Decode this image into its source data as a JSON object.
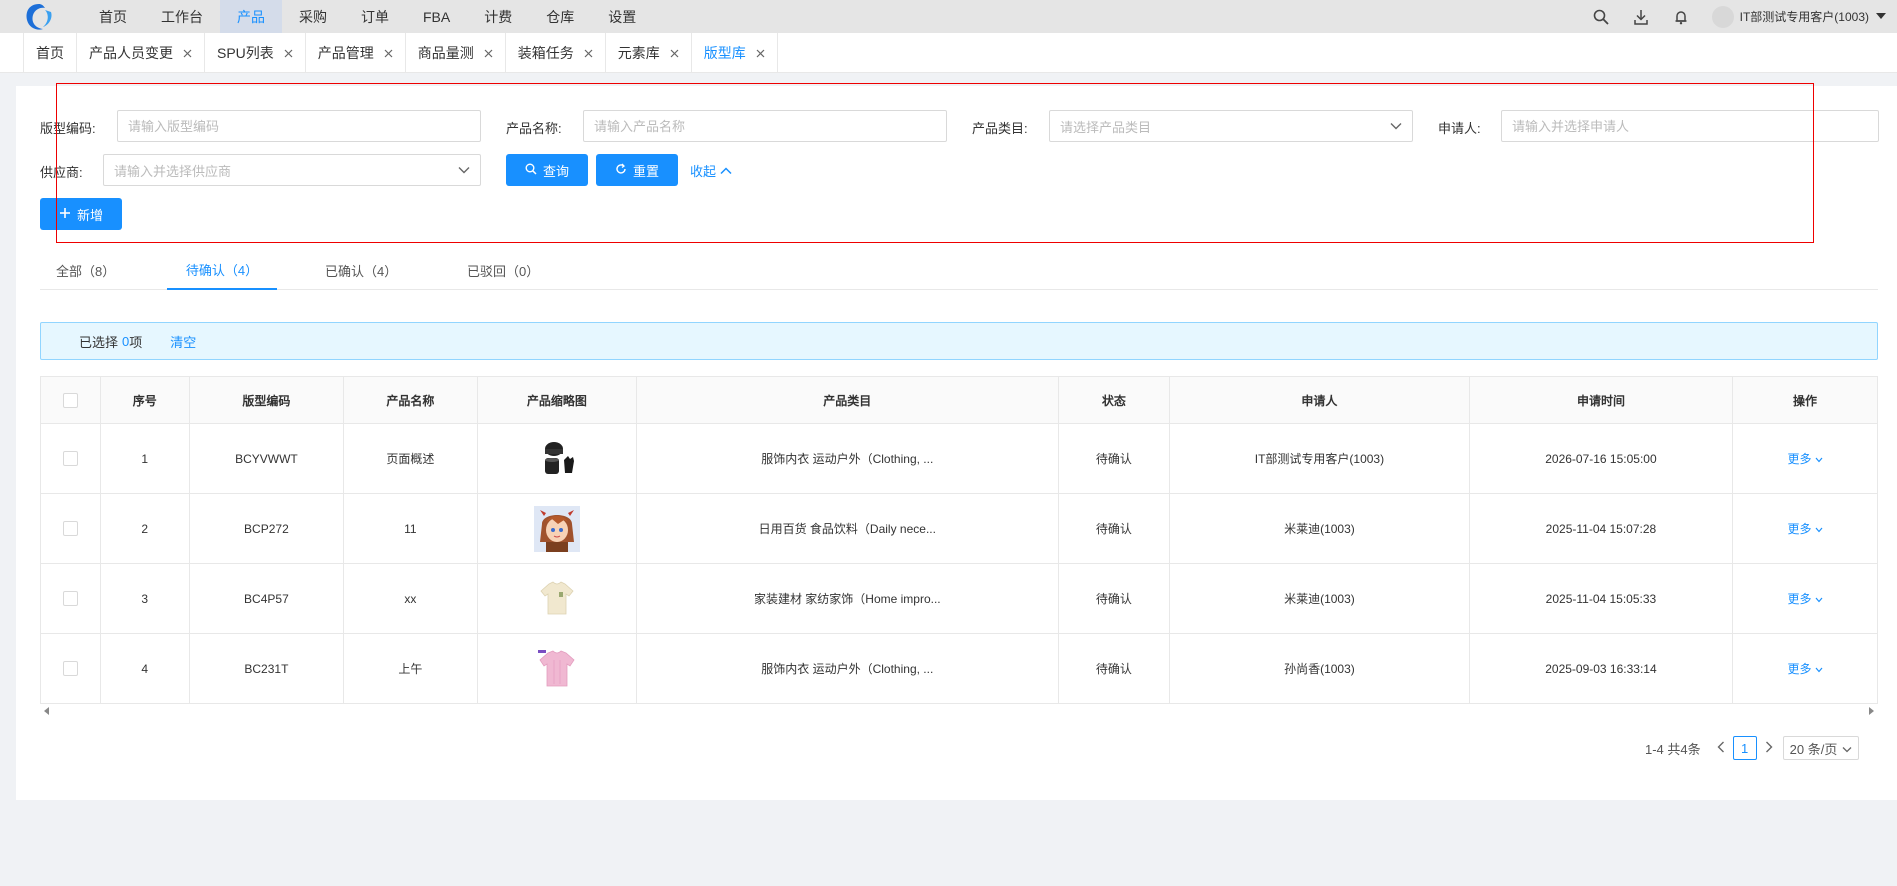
{
  "nav": {
    "items": [
      "首页",
      "工作台",
      "产品",
      "采购",
      "订单",
      "FBA",
      "计费",
      "仓库",
      "设置"
    ],
    "active_index": 2,
    "user_label": "IT部测试专用客户(1003)",
    "icons": [
      "search-icon",
      "download-icon",
      "bell-icon",
      "caret-down-icon"
    ]
  },
  "tabs": [
    {
      "label": "首页",
      "closable": false
    },
    {
      "label": "产品人员变更",
      "closable": true
    },
    {
      "label": "SPU列表",
      "closable": true
    },
    {
      "label": "产品管理",
      "closable": true
    },
    {
      "label": "商品量测",
      "closable": true
    },
    {
      "label": "装箱任务",
      "closable": true
    },
    {
      "label": "元素库",
      "closable": true
    },
    {
      "label": "版型库",
      "closable": true,
      "active": true
    }
  ],
  "filters": {
    "code_label": "版型编码:",
    "code_placeholder": "请输入版型编码",
    "name_label": "产品名称:",
    "name_placeholder": "请输入产品名称",
    "category_label": "产品类目:",
    "category_placeholder": "请选择产品类目",
    "applicant_label": "申请人:",
    "applicant_placeholder": "请输入并选择申请人",
    "supplier_label": "供应商:",
    "supplier_placeholder": "请输入并选择供应商",
    "search_label": "查询",
    "reset_label": "重置",
    "collapse_label": "收起",
    "add_label": "新增"
  },
  "status_tabs": [
    {
      "label": "全部（8）"
    },
    {
      "label": "待确认（4）",
      "active": true
    },
    {
      "label": "已确认（4）"
    },
    {
      "label": "已驳回（0）"
    }
  ],
  "selection": {
    "prefix": "已选择",
    "count": "0",
    "suffix": "项",
    "clear_label": "清空"
  },
  "table": {
    "columns": [
      "序号",
      "版型编码",
      "产品名称",
      "产品缩略图",
      "产品类目",
      "状态",
      "申请人",
      "申请时间",
      "操作"
    ],
    "rows": [
      {
        "index": "1",
        "code": "BCYVWWT",
        "name": "页面概述",
        "thumb": "hat-gloves",
        "category": "服饰内衣 运动户外（Clothing, ...",
        "status": "待确认",
        "applicant": "IT部测试专用客户(1003)",
        "time": "2026-07-16 15:05:00",
        "action": "更多"
      },
      {
        "index": "2",
        "code": "BCP272",
        "name": "11",
        "thumb": "anime-avatar",
        "category": "日用百货 食品饮料（Daily nece...",
        "status": "待确认",
        "applicant": "米莱迪(1003)",
        "time": "2025-11-04 15:07:28",
        "action": "更多"
      },
      {
        "index": "3",
        "code": "BC4P57",
        "name": "xx",
        "thumb": "beige-tshirt",
        "category": "家装建材 家纺家饰（Home impro...",
        "status": "待确认",
        "applicant": "米莱迪(1003)",
        "time": "2025-11-04 15:05:33",
        "action": "更多"
      },
      {
        "index": "4",
        "code": "BC231T",
        "name": "上午",
        "thumb": "pink-tshirt",
        "category": "服饰内衣 运动户外（Clothing, ...",
        "status": "待确认",
        "applicant": "孙尚香(1003)",
        "time": "2025-09-03 16:33:14",
        "action": "更多"
      }
    ]
  },
  "pagination": {
    "summary": "1-4 共4条",
    "current_page": "1",
    "page_size": "20 条/页"
  },
  "colors": {
    "primary": "#1890ff",
    "highlight_box": "#e00000"
  }
}
